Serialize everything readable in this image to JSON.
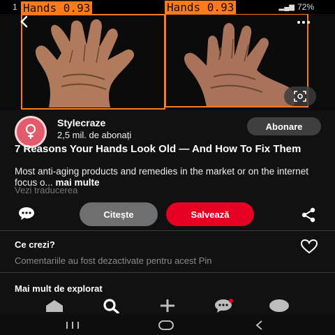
{
  "status_bar": {
    "time_fragment": "1",
    "battery_label": "72%",
    "signal_label": "▂▄▆"
  },
  "detections": [
    {
      "label": "Hands 0.93"
    },
    {
      "label": "Hands 0.93"
    }
  ],
  "pin": {
    "creator_name": "Stylecraze",
    "followers": "2,5 mil. de abonați",
    "follow_label": "Abonare",
    "title": "7 Reasons Your Hands Look Old — And How To Fix Them",
    "description": "Most anti-aging products and remedies in the market or on the internet focus o...",
    "more_label": "mai multe",
    "translate_label": "Vezi traducerea"
  },
  "actions": {
    "read_label": "Citește",
    "save_label": "Salvează"
  },
  "comments": {
    "heading": "Ce crezi?",
    "disabled_text": "Comentariile au fost dezactivate pentru acest Pin"
  },
  "explore": {
    "heading": "Mai mult de explorat"
  },
  "bottom_nav": {
    "items": [
      "home-icon",
      "search-icon",
      "create-icon",
      "messages-icon",
      "profile-icon"
    ]
  },
  "system_nav": {
    "items": [
      "recents-icon",
      "home-button-icon",
      "back-icon"
    ]
  },
  "colors": {
    "accent_red": "#e60023",
    "detection_orange": "#ff7a1a",
    "background": "#111111"
  }
}
